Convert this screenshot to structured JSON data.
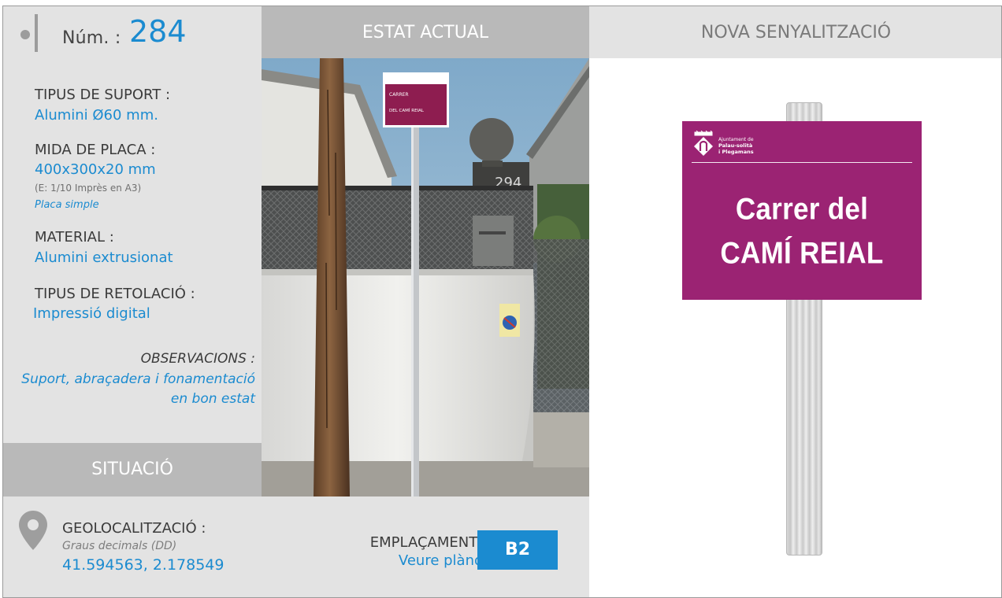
{
  "header": {
    "num_label": "Núm. :",
    "num_value": "284",
    "estat_title": "ESTAT ACTUAL",
    "nova_title": "NOVA SENYALITZACIÓ"
  },
  "specs": {
    "suport_label": "TIPUS DE SUPORT :",
    "suport_value": "Alumini Ø60 mm.",
    "mida_label": "MIDA DE PLACA :",
    "mida_value": "400x300x20 mm",
    "mida_scale": "(E: 1/10 Imprès en A3)",
    "mida_type": "Placa simple",
    "material_label": "MATERIAL :",
    "material_value": "Alumini extrusionat",
    "retolacio_label": "TIPUS DE RETOLACIÓ :",
    "retolacio_value": "Impressió digital",
    "obs_label": "OBSERVACIONS :",
    "obs_value": "Suport, abraçadera i fonamentació en bon estat"
  },
  "situacio": {
    "title": "SITUACIÓ",
    "geo_label": "GEOLOCALITZACIÓ :",
    "geo_sub": "Graus decimals (DD)",
    "geo_coords": "41.594563, 2.178549",
    "empl_label": "EMPLAÇAMENT :",
    "empl_link": "Veure plànol",
    "empl_code": "B2"
  },
  "photo": {
    "sign_line1": "CARRER",
    "sign_line2": "DEL CAMÍ REIAL",
    "house_number": "294"
  },
  "new_sign": {
    "org_line1": "Ajuntament de",
    "org_line2": "Palau-solità",
    "org_line3": "i Plegamans",
    "line1": "Carrer del",
    "line2": "CAMÍ REIAL"
  },
  "colors": {
    "accent_blue": "#1b8bd0",
    "sign_magenta": "#9b2373",
    "header_grey": "#b9b9b9",
    "panel_grey": "#e3e3e3"
  },
  "icons": [
    "location-pin-icon",
    "municipal-logo-icon"
  ]
}
